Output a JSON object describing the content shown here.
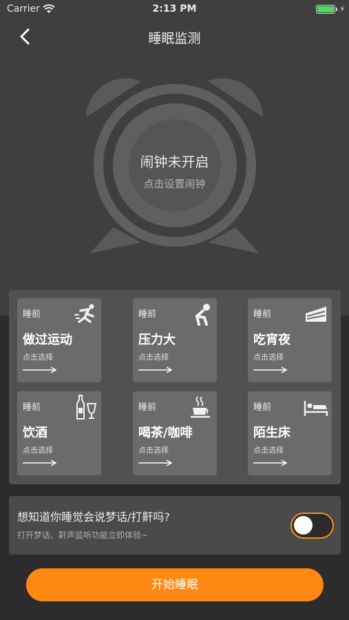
{
  "status_bar": {
    "carrier": "Carrier",
    "time": "2:13 PM"
  },
  "nav": {
    "title": "睡眠监测"
  },
  "alarm": {
    "status": "闹钟未开启",
    "hint": "点击设置闹钟"
  },
  "cards": [
    {
      "pre": "睡前",
      "title": "做过运动",
      "hint": "点击选择",
      "icon": "running-icon"
    },
    {
      "pre": "睡前",
      "title": "压力大",
      "hint": "点击选择",
      "icon": "stress-icon"
    },
    {
      "pre": "睡前",
      "title": "吃宵夜",
      "hint": "点击选择",
      "icon": "cake-icon"
    },
    {
      "pre": "睡前",
      "title": "饮酒",
      "hint": "点击选择",
      "icon": "wine-icon"
    },
    {
      "pre": "睡前",
      "title": "喝茶/咖啡",
      "hint": "点击选择",
      "icon": "coffee-icon"
    },
    {
      "pre": "睡前",
      "title": "陌生床",
      "hint": "点击选择",
      "icon": "bed-icon"
    }
  ],
  "dream": {
    "title": "想知道你睡觉会说梦话/打鼾吗?",
    "subtitle": "打开梦话、鼾声监听功能立即体验~",
    "toggle_on": false
  },
  "start_button": "开始睡眠",
  "colors": {
    "accent": "#ff8812",
    "top_bg": "#3f3f3f",
    "bottom_bg": "#2c2c2c"
  }
}
